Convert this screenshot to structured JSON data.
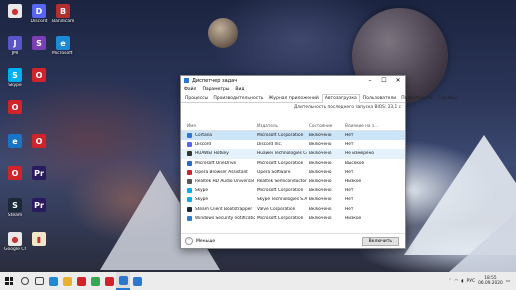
{
  "desktop_icons": [
    {
      "name": "chrome-icon",
      "label": "",
      "color": "#e8e8e8",
      "glyph": "●"
    },
    {
      "name": "discord-icon",
      "label": "Discord",
      "color": "#5865f2",
      "glyph": "D"
    },
    {
      "name": "bandicam-icon",
      "label": "Bandicam",
      "color": "#b32f2f",
      "glyph": "B"
    },
    {
      "name": "jmi-icon",
      "label": "JMI",
      "color": "#5a56c8",
      "glyph": "J"
    },
    {
      "name": "app-icon",
      "label": "",
      "color": "#7b3fb5",
      "glyph": "S"
    },
    {
      "name": "edge-icon",
      "label": "Microsoft Edge",
      "color": "#1e8ad6",
      "glyph": "e"
    },
    {
      "name": "skype-icon",
      "label": "Skype",
      "color": "#00aff0",
      "glyph": "S"
    },
    {
      "name": "opera-icon",
      "label": "",
      "color": "#d1232a",
      "glyph": "O"
    },
    {
      "name": "opera-gx-icon",
      "label": "",
      "color": "#d1232a",
      "glyph": "O"
    },
    {
      "name": "ie-icon",
      "label": "",
      "color": "#1a73c7",
      "glyph": "e"
    },
    {
      "name": "opera-icon-2",
      "label": "",
      "color": "#d1232a",
      "glyph": "O"
    },
    {
      "name": "opera-icon-3",
      "label": "",
      "color": "#d1232a",
      "glyph": "O"
    },
    {
      "name": "premiere-icon",
      "label": "",
      "color": "#2a1a5e",
      "glyph": "Pr"
    },
    {
      "name": "steam-icon",
      "label": "Steam",
      "color": "#1b2838",
      "glyph": "S"
    },
    {
      "name": "premiere-icon-2",
      "label": "",
      "color": "#2a1a5e",
      "glyph": "Pr"
    },
    {
      "name": "chrome-icon-2",
      "label": "Google Chrome",
      "color": "#e8e8e8",
      "glyph": "●"
    },
    {
      "name": "file-icon",
      "label": "",
      "color": "#f0e6c8",
      "glyph": "▮"
    }
  ],
  "window": {
    "title": "Диспетчер задач",
    "menu": [
      "Файл",
      "Параметры",
      "Вид"
    ],
    "tabs": [
      "Процессы",
      "Производительность",
      "Журнал приложений",
      "Автозагрузка",
      "Пользователи",
      "Подробности",
      "Службы"
    ],
    "active_tab": "Автозагрузка",
    "boot_time": "Длительность последнего запуска BIOS: 23,1 с",
    "columns": [
      "Имя",
      "Издатель",
      "Состояние",
      "Влияние на з..."
    ],
    "rows": [
      {
        "name": "Cortana",
        "publisher": "Microsoft Corporation",
        "status": "Включено",
        "impact": "Нет",
        "color": "#2b78d1"
      },
      {
        "name": "Discord",
        "publisher": "Discord Inc.",
        "status": "Включено",
        "impact": "Нет",
        "color": "#5865f2"
      },
      {
        "name": "HUAWEI Hotkey",
        "publisher": "Huawei Technologies Co....",
        "status": "Включено",
        "impact": "Не измерено",
        "color": "#333333"
      },
      {
        "name": "Microsoft OneDrive",
        "publisher": "Microsoft Corporation",
        "status": "Включено",
        "impact": "Высокое",
        "color": "#1e6fd0"
      },
      {
        "name": "Opera Browser Assistant",
        "publisher": "Opera Software",
        "status": "Включено",
        "impact": "Нет",
        "color": "#d1232a"
      },
      {
        "name": "Realtek HD Audio Universal ...",
        "publisher": "Realtek Semiconductor",
        "status": "Включено",
        "impact": "Низкое",
        "color": "#555555"
      },
      {
        "name": "Skype",
        "publisher": "Microsoft Corporation",
        "status": "Включено",
        "impact": "Нет",
        "color": "#00aff0"
      },
      {
        "name": "Skype",
        "publisher": "Skype Technologies S.A.",
        "status": "Включено",
        "impact": "Нет",
        "color": "#00aff0"
      },
      {
        "name": "Steam Client Bootstrapper",
        "publisher": "Valve Corporation",
        "status": "Включено",
        "impact": "Нет",
        "color": "#1b2838"
      },
      {
        "name": "Windows Security notificatio...",
        "publisher": "Microsoft Corporation",
        "status": "Включено",
        "impact": "Низкое",
        "color": "#2b78d1"
      }
    ],
    "less_label": "Меньше",
    "disable_label": "Включить"
  },
  "taskbar": {
    "apps": [
      {
        "name": "search-icon",
        "color": "#444444"
      },
      {
        "name": "task-view-icon",
        "color": "#444444"
      },
      {
        "name": "edge-taskbar-icon",
        "color": "#1e8ad6"
      },
      {
        "name": "folder-taskbar-icon",
        "color": "#e8b030"
      },
      {
        "name": "opera-taskbar-icon",
        "color": "#d1232a"
      },
      {
        "name": "chrome-taskbar-icon",
        "color": "#34a853"
      },
      {
        "name": "opera-gx-taskbar-icon",
        "color": "#d1232a"
      },
      {
        "name": "task-manager-taskbar-icon",
        "color": "#2b78d1"
      },
      {
        "name": "store-taskbar-icon",
        "color": "#2b78d1"
      }
    ],
    "time": "18:55",
    "date": "06.09.2020",
    "lang": "РУС"
  }
}
